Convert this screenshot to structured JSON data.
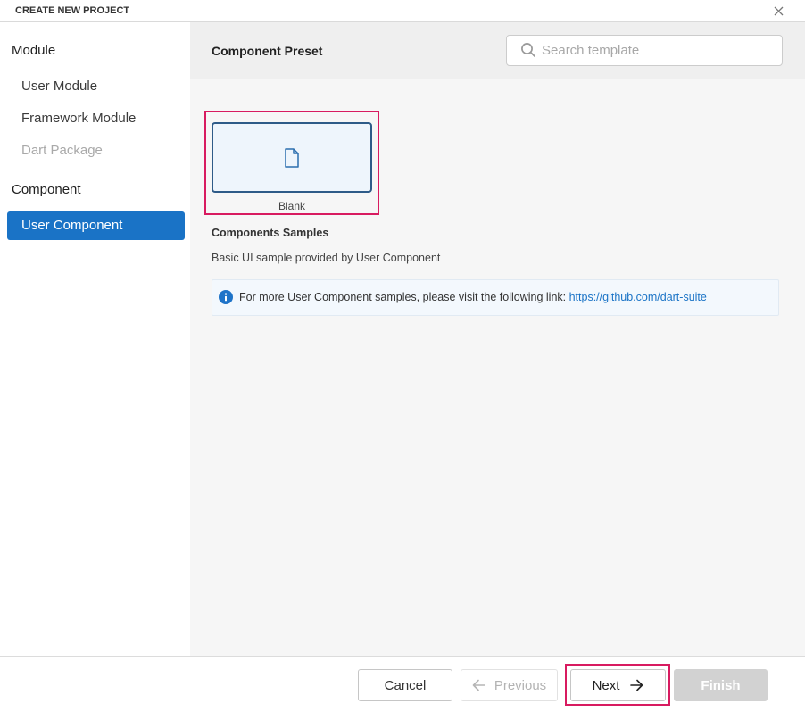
{
  "window": {
    "title": "CREATE NEW PROJECT",
    "close_icon": "close-icon"
  },
  "sidebar": {
    "sections": [
      {
        "header": "Module",
        "items": [
          {
            "label": "User Module",
            "selected": false,
            "disabled": false
          },
          {
            "label": "Framework Module",
            "selected": false,
            "disabled": false
          },
          {
            "label": "Dart Package",
            "selected": false,
            "disabled": true
          }
        ]
      },
      {
        "header": "Component",
        "items": [
          {
            "label": "User Component",
            "selected": true,
            "disabled": false
          }
        ]
      }
    ]
  },
  "main": {
    "title": "Component Preset",
    "search": {
      "icon": "search-icon",
      "placeholder": "Search template"
    },
    "presets": [
      {
        "label": "Blank",
        "icon": "document-icon",
        "selected": true,
        "highlighted": true
      }
    ],
    "samples": {
      "title": "Components Samples",
      "description": "Basic UI sample provided by User Component"
    },
    "info": {
      "icon": "info-icon",
      "text": "For more User Component samples, please visit the following link: ",
      "link": "https://github.com/dart-suite"
    }
  },
  "footer": {
    "cancel": {
      "label": "Cancel",
      "disabled": false
    },
    "previous": {
      "label": "Previous",
      "icon": "arrow-left-icon",
      "disabled": true
    },
    "next": {
      "label": "Next",
      "icon": "arrow-right-icon",
      "disabled": false,
      "highlighted": true
    },
    "finish": {
      "label": "Finish",
      "disabled": true
    }
  },
  "colors": {
    "accent": "#1a73c6",
    "highlight_annotation": "#d81b60",
    "preset_card_border": "#2e5b88",
    "disabled_text": "#a9a9a9",
    "finish_disabled_bg": "#d2d2d2"
  }
}
